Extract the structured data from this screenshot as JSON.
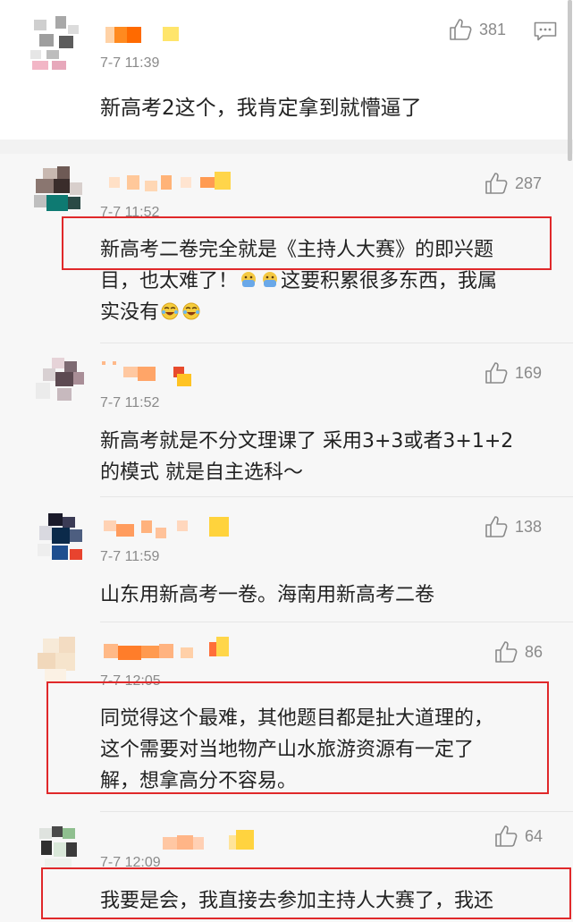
{
  "main": {
    "time": "7-7 11:39",
    "likes": "381",
    "text": "新高考2这个，我肯定拿到就懵逼了"
  },
  "replies": [
    {
      "time": "7-7 11:52",
      "likes": "287",
      "text_a": "新高考二卷完全就是《主持人大赛》的即兴题",
      "text_b": "目，也太难了！",
      "text_c": "这要积累很多东西，我属",
      "text_d": "实没有"
    },
    {
      "time": "7-7 11:52",
      "likes": "169",
      "line1": "新高考就是不分文理课了 采用3+3或者3+1+2",
      "line2": "的模式 就是自主选科～"
    },
    {
      "time": "7-7 11:59",
      "likes": "138",
      "line1": "山东用新高考一卷。海南用新高考二卷"
    },
    {
      "time": "7-7 12:05",
      "likes": "86",
      "line1": "同觉得这个最难，其他题目都是扯大道理的，",
      "line2": "这个需要对当地物产山水旅游资源有一定了",
      "line3": "解，想拿高分不容易。"
    },
    {
      "time": "7-7 12:09",
      "likes": "64",
      "line1": "我要是会，我直接去参加主持人大赛了，我还"
    }
  ],
  "icons": {
    "like": "thumbs-up-icon",
    "reply": "comment-icon",
    "emoji_face_palm": "face-palm-emoji",
    "emoji_laugh": "laughing-crying-emoji"
  },
  "colors": {
    "highlight": "#e0282a",
    "muted": "#8a8a8a",
    "text": "#222222"
  }
}
